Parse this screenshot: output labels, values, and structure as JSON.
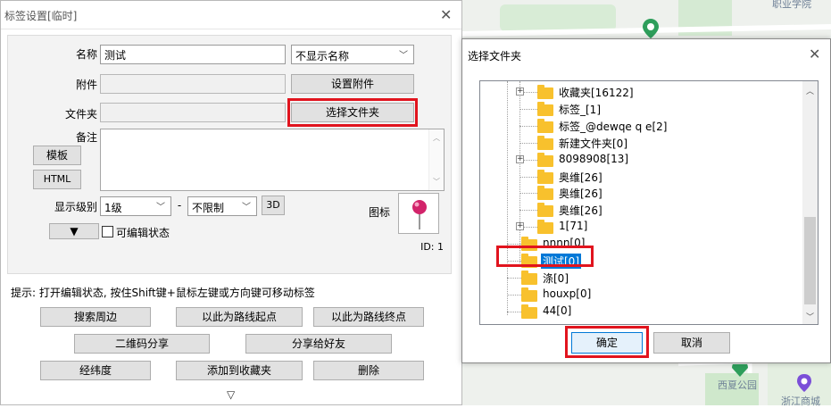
{
  "map": {
    "labels": [
      "职业学院",
      "西夏公园",
      "浙江商城"
    ]
  },
  "tag_dialog": {
    "title": "标签设置[临时]",
    "name_label": "名称",
    "name_value": "测试",
    "name_display_option": "不显示名称",
    "attachment_label": "附件",
    "attachment_button": "设置附件",
    "folder_label": "文件夹",
    "folder_button": "选择文件夹",
    "note_label": "备注",
    "template_button": "模板",
    "html_button": "HTML",
    "display_level_label": "显示级别",
    "level_value": "1级",
    "dash": "-",
    "limit_value": "不限制",
    "button_3d": "3D",
    "icon_label": "图标",
    "editable_label": "可编辑状态",
    "id_text": "ID: 1",
    "hint": "提示: 打开编辑状态, 按住Shift键+鼠标左键或方向键可移动标签",
    "actions": {
      "search_nearby": "搜索周边",
      "route_start": "以此为路线起点",
      "route_end": "以此为路线终点",
      "qr_share": "二维码分享",
      "share_friend": "分享给好友",
      "lat_lng": "经纬度",
      "add_favorite": "添加到收藏夹",
      "delete": "删除"
    },
    "expand_glyph": "▽"
  },
  "folder_dialog": {
    "title": "选择文件夹",
    "ok_button": "确定",
    "cancel_button": "取消",
    "tree_items": [
      {
        "label": "收藏夹[16122]",
        "expandable": true
      },
      {
        "label": "标签_[1]",
        "expandable": false
      },
      {
        "label": "标签_@dewqe q e[2]",
        "expandable": false
      },
      {
        "label": "新建文件夹[0]",
        "expandable": false
      },
      {
        "label": "8098908[13]",
        "expandable": true
      },
      {
        "label": "奥维[26]",
        "expandable": false
      },
      {
        "label": "奥维[26]",
        "expandable": false
      },
      {
        "label": "奥维[26]",
        "expandable": false
      },
      {
        "label": "1[71]",
        "expandable": true
      },
      {
        "label": "nnnn[0]",
        "expandable": false
      },
      {
        "label": "测试[0]",
        "expandable": false,
        "selected": true
      },
      {
        "label": "涤[0]",
        "expandable": false
      },
      {
        "label": "houxp[0]",
        "expandable": false
      },
      {
        "label": "44[0]",
        "expandable": false
      }
    ]
  },
  "colors": {
    "highlight_red": "#e1141e",
    "selection_blue": "#0078d7",
    "folder_yellow": "#f8c12d",
    "map_pin_green": "#2e9e5b",
    "map_pin_purple": "#7b4fd8",
    "pushpin_red": "#d2236a"
  },
  "icons": [
    "close-icon",
    "chevron-down-icon",
    "pushpin-icon",
    "folder-icon",
    "map-pin-icon",
    "expand-arrow-icon"
  ]
}
